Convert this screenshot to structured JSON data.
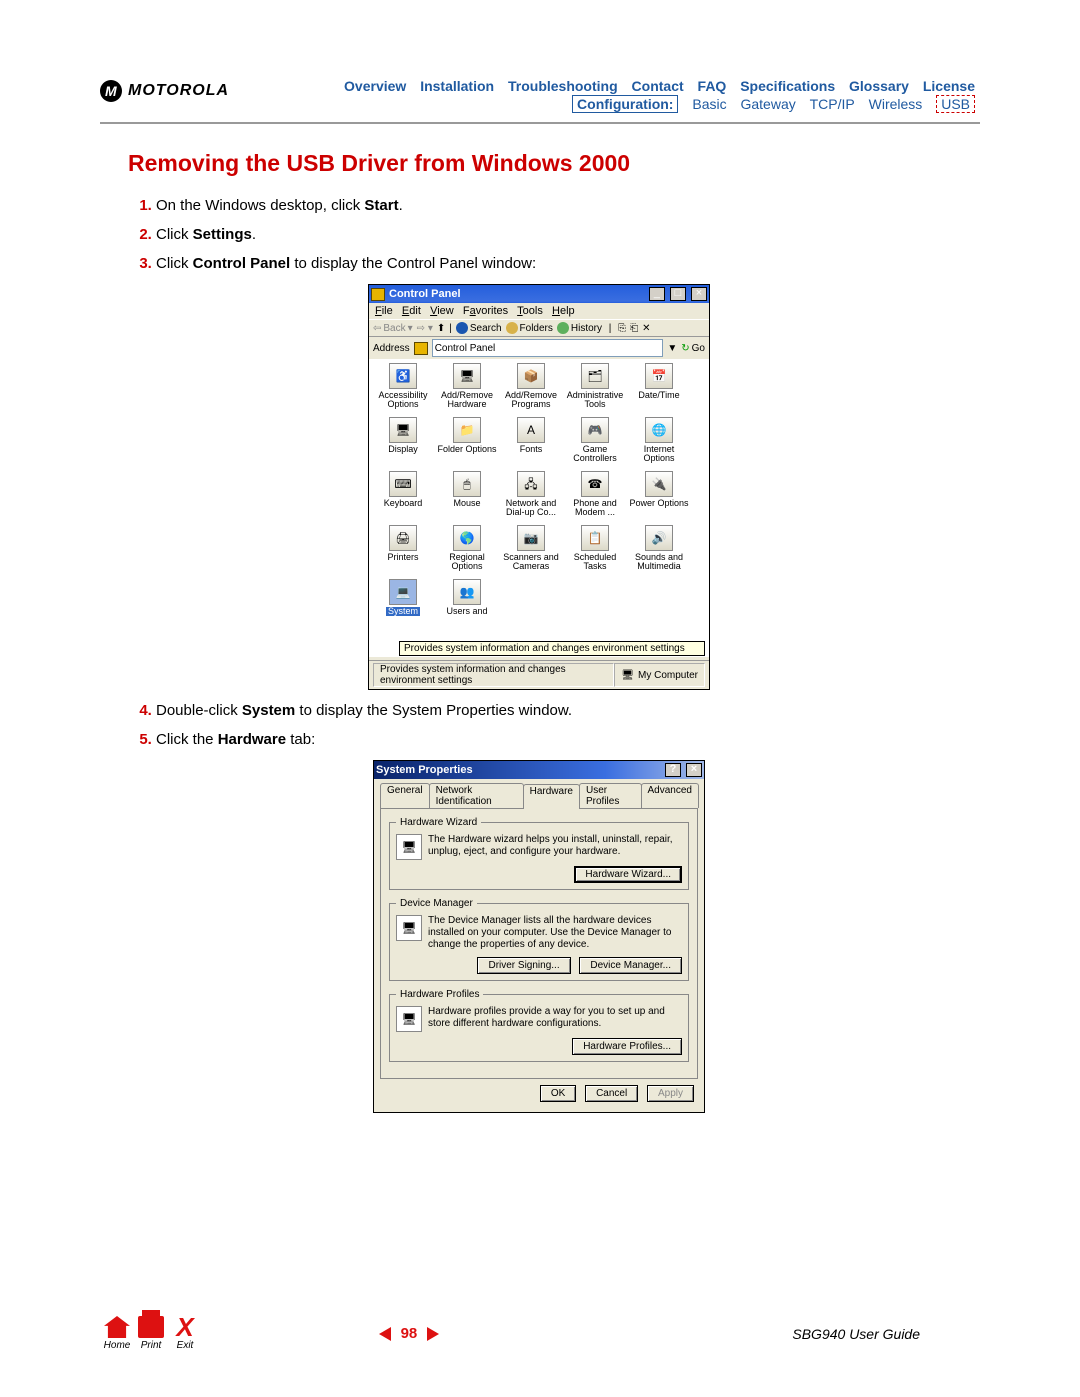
{
  "header": {
    "brand": "MOTOROLA",
    "nav_top": [
      "Overview",
      "Installation",
      "Troubleshooting",
      "Contact",
      "FAQ",
      "Specifications",
      "Glossary",
      "License"
    ],
    "nav_sub": {
      "boxed": "Configuration:",
      "items": [
        "Basic",
        "Gateway",
        "TCP/IP",
        "Wireless"
      ],
      "dashed": "USB"
    }
  },
  "title": "Removing the USB Driver from Windows 2000",
  "steps": {
    "s1_pre": "On the Windows desktop, click ",
    "s1_b": "Start",
    "s1_post": ".",
    "s2_pre": "Click ",
    "s2_b": "Settings",
    "s2_post": ".",
    "s3_pre": "Click ",
    "s3_b": "Control Panel",
    "s3_post": " to display the Control Panel window:",
    "s4_pre": "Double-click ",
    "s4_b": "System",
    "s4_post": " to display the System Properties window.",
    "s5_pre": "Click the ",
    "s5_b": "Hardware",
    "s5_post": " tab:"
  },
  "control_panel": {
    "title": "Control Panel",
    "menu": {
      "file": "File",
      "edit": "Edit",
      "view": "View",
      "fav": "Favorites",
      "tools": "Tools",
      "help": "Help"
    },
    "toolbar": {
      "back": "Back",
      "search": "Search",
      "folders": "Folders",
      "history": "History"
    },
    "address_label": "Address",
    "address_value": "Control Panel",
    "go": "Go",
    "items": [
      {
        "g": "♿",
        "l": "Accessibility Options"
      },
      {
        "g": "🖥",
        "l": "Add/Remove Hardware"
      },
      {
        "g": "📦",
        "l": "Add/Remove Programs"
      },
      {
        "g": "🗂",
        "l": "Administrative Tools"
      },
      {
        "g": "📅",
        "l": "Date/Time"
      },
      {
        "g": "🖥",
        "l": "Display"
      },
      {
        "g": "📁",
        "l": "Folder Options"
      },
      {
        "g": "A",
        "l": "Fonts"
      },
      {
        "g": "🎮",
        "l": "Game Controllers"
      },
      {
        "g": "🌐",
        "l": "Internet Options"
      },
      {
        "g": "⌨",
        "l": "Keyboard"
      },
      {
        "g": "🖱",
        "l": "Mouse"
      },
      {
        "g": "🖧",
        "l": "Network and Dial-up Co..."
      },
      {
        "g": "☎",
        "l": "Phone and Modem ..."
      },
      {
        "g": "🔌",
        "l": "Power Options"
      },
      {
        "g": "🖨",
        "l": "Printers"
      },
      {
        "g": "🌎",
        "l": "Regional Options"
      },
      {
        "g": "📷",
        "l": "Scanners and Cameras"
      },
      {
        "g": "📋",
        "l": "Scheduled Tasks"
      },
      {
        "g": "🔊",
        "l": "Sounds and Multimedia"
      },
      {
        "g": "💻",
        "l": "System",
        "sel": true
      },
      {
        "g": "👥",
        "l": "Users and"
      }
    ],
    "tooltip": "Provides system information and changes environment settings",
    "status_left": "Provides system information and changes environment settings",
    "status_right": "My Computer"
  },
  "sysprops": {
    "title": "System Properties",
    "tabs": [
      "General",
      "Network Identification",
      "Hardware",
      "User Profiles",
      "Advanced"
    ],
    "active_tab": 2,
    "hw_wizard": {
      "legend": "Hardware Wizard",
      "text": "The Hardware wizard helps you install, uninstall, repair, unplug, eject, and configure your hardware.",
      "btn": "Hardware Wizard..."
    },
    "dev_mgr": {
      "legend": "Device Manager",
      "text": "The Device Manager lists all the hardware devices installed on your computer. Use the Device Manager to change the properties of any device.",
      "btn1": "Driver Signing...",
      "btn2": "Device Manager..."
    },
    "hw_prof": {
      "legend": "Hardware Profiles",
      "text": "Hardware profiles provide a way for you to set up and store different hardware configurations.",
      "btn": "Hardware Profiles..."
    },
    "ok": "OK",
    "cancel": "Cancel",
    "apply": "Apply"
  },
  "footer": {
    "home": "Home",
    "print": "Print",
    "exit": "Exit",
    "page": "98",
    "guide": "SBG940 User Guide"
  }
}
